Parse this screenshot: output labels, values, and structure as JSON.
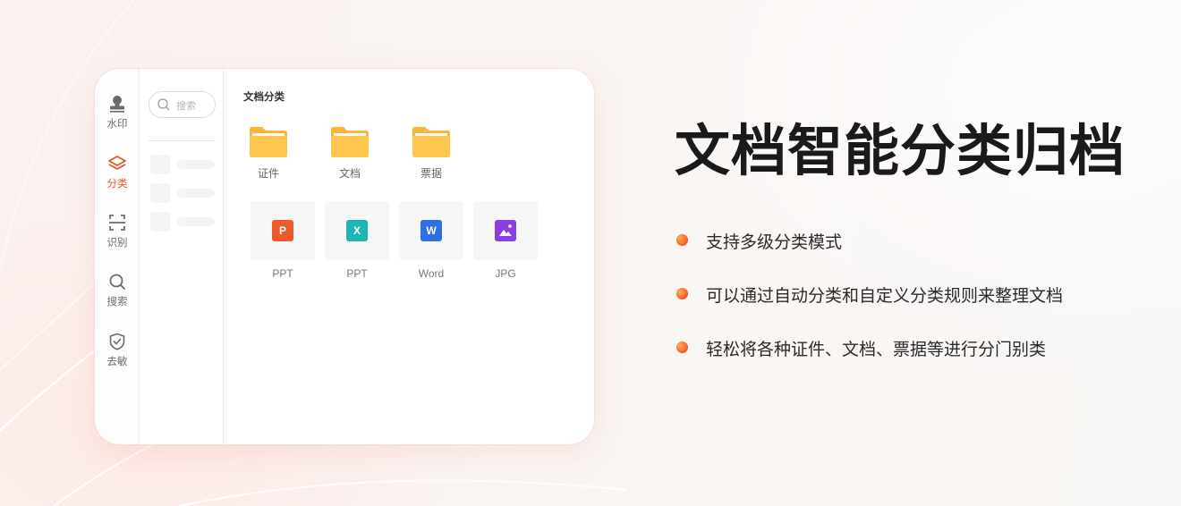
{
  "app": {
    "rail": [
      {
        "label": "水印",
        "icon": "stamp-icon",
        "active": false
      },
      {
        "label": "分类",
        "icon": "layers-icon",
        "active": true
      },
      {
        "label": "识别",
        "icon": "scan-icon",
        "active": false
      },
      {
        "label": "搜索",
        "icon": "search-icon",
        "active": false
      },
      {
        "label": "去敏",
        "icon": "shield-check-icon",
        "active": false
      }
    ],
    "search_placeholder": "搜索",
    "section_title": "文档分类",
    "folders": [
      {
        "label": "证件"
      },
      {
        "label": "文档"
      },
      {
        "label": "票据"
      }
    ],
    "files": [
      {
        "label": "PPT",
        "badge": "P",
        "color": "#f05a2a"
      },
      {
        "label": "PPT",
        "badge": "X",
        "color": "#1fb5b5"
      },
      {
        "label": "Word",
        "badge": "W",
        "color": "#2f6fe4"
      },
      {
        "label": "JPG",
        "badge": "img",
        "color": "#8b3fe0"
      }
    ]
  },
  "hero": {
    "headline": "文档智能分类归档",
    "features": [
      "支持多级分类模式",
      "可以通过自动分类和自定义分类规则来整理文档",
      "轻松将各种证件、文档、票据等进行分门别类"
    ]
  },
  "colors": {
    "accent": "#e0562a",
    "folder": "#fcbf45"
  }
}
